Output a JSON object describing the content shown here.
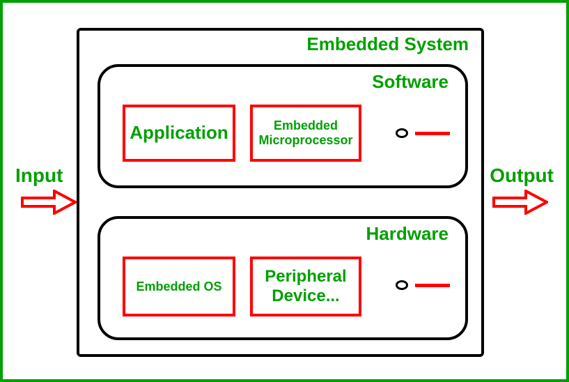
{
  "system_title": "Embedded System",
  "software": {
    "title": "Software",
    "box1": "Application",
    "box2": "Embedded Microprocessor"
  },
  "hardware": {
    "title": "Hardware",
    "box1": "Embedded OS",
    "box2": "Peripheral Device..."
  },
  "io": {
    "input": "Input",
    "output": "Output"
  },
  "colors": {
    "outer_border": "#00a000",
    "text_green": "#00a000",
    "box_red": "#ff0000",
    "panel_black": "#000000"
  }
}
